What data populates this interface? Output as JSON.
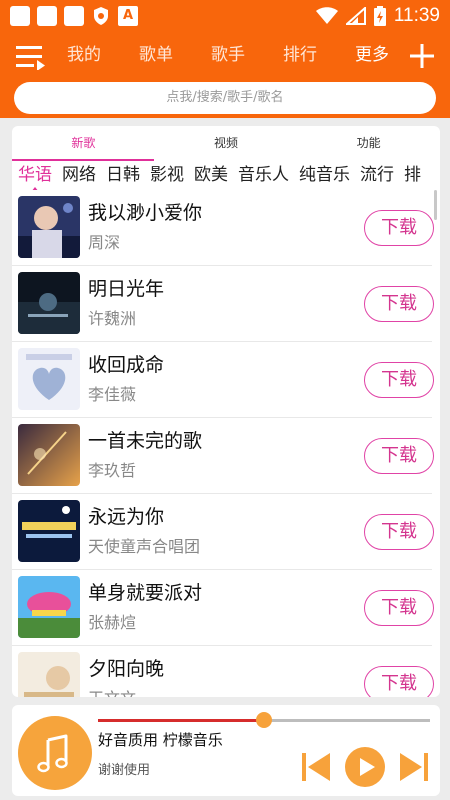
{
  "status_bar": {
    "time": "11:39",
    "left_icons": [
      "notification-icon",
      "notification-icon",
      "notification-icon",
      "shield-icon",
      "a-icon"
    ],
    "a_label": "A",
    "right_icons": [
      "wifi-icon",
      "signal-icon",
      "battery-charging-icon"
    ]
  },
  "header": {
    "nav": [
      "我的",
      "歌单",
      "歌手",
      "排行",
      "更多"
    ],
    "active_nav": 4,
    "search_placeholder": "点我/搜索/歌手/歌名"
  },
  "tabs": [
    "新歌",
    "视频",
    "功能"
  ],
  "active_tab": 0,
  "genres": [
    "华语",
    "网络",
    "日韩",
    "影视",
    "欧美",
    "音乐人",
    "纯音乐",
    "流行",
    "排"
  ],
  "active_genre": 0,
  "songs": [
    {
      "title": "我以渺小爱你",
      "artist": "周深",
      "button": "下载"
    },
    {
      "title": "明日光年",
      "artist": "许魏洲",
      "button": "下载"
    },
    {
      "title": "收回成命",
      "artist": "李佳薇",
      "button": "下载"
    },
    {
      "title": "一首未完的歌",
      "artist": "李玖哲",
      "button": "下载"
    },
    {
      "title": "永远为你",
      "artist": "天使童声合唱团",
      "button": "下载"
    },
    {
      "title": "单身就要派对",
      "artist": "张赫煊",
      "button": "下载"
    },
    {
      "title": "夕阳向晚",
      "artist": "王文文",
      "button": "下载"
    }
  ],
  "player": {
    "title": "好音质用 柠檬音乐",
    "subtitle": "谢谢使用",
    "progress": 0.5
  },
  "colors": {
    "accent": "#f8660c",
    "pink": "#e0309a",
    "player_orange": "#f6a43c",
    "progress_red": "#d62c2c"
  }
}
